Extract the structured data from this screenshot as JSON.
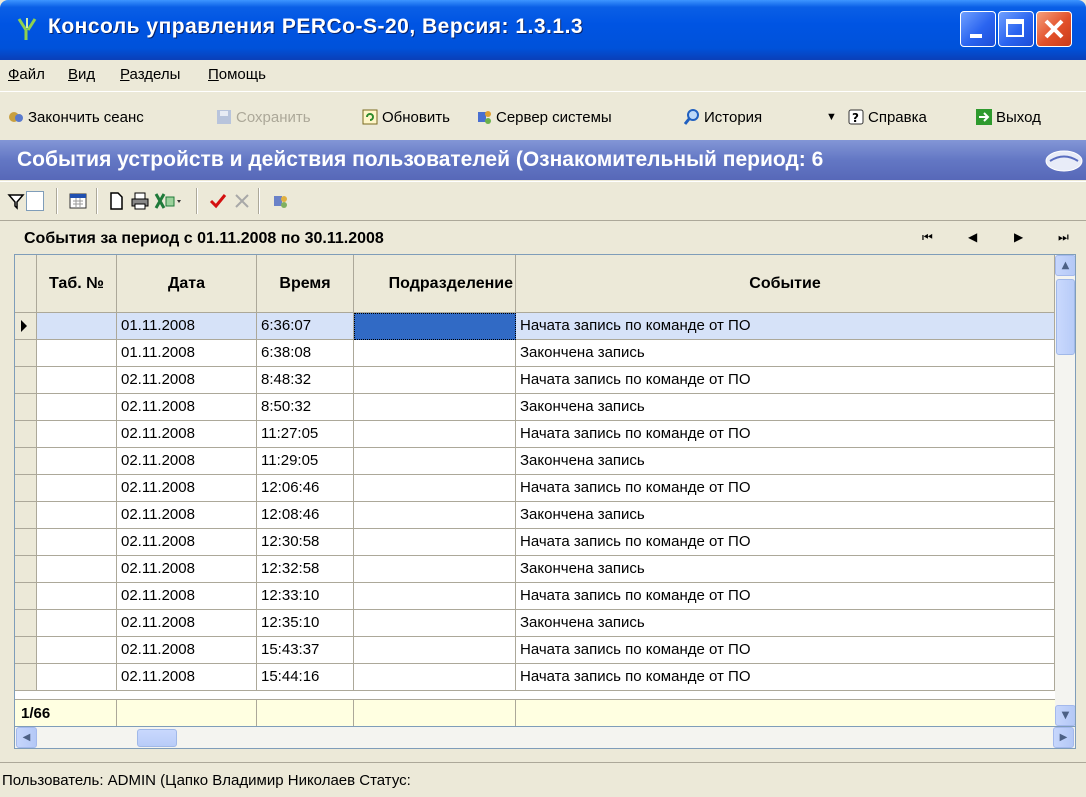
{
  "window": {
    "title": "Консоль управления PERCo-S-20, Версия: 1.3.1.3"
  },
  "menu": [
    "Файл",
    "Вид",
    "Разделы",
    "Помощь"
  ],
  "toolbar": {
    "end_session": "Закончить сеанс",
    "save": "Сохранить",
    "refresh": "Обновить",
    "server": "Сервер системы",
    "history": "История",
    "help": "Справка",
    "exit": "Выход"
  },
  "section": {
    "title": "События устройств и действия пользователей (Ознакомительный период: 6"
  },
  "period": {
    "label": "События за период с 01.11.2008  по 30.11.2008"
  },
  "grid": {
    "columns": [
      "Таб. №",
      "Дата",
      "Время",
      "Подразделение",
      "Событие"
    ],
    "rows": [
      [
        "",
        "01.11.2008",
        "6:36:07",
        "",
        "Начата запись по команде от ПО"
      ],
      [
        "",
        "01.11.2008",
        "6:38:08",
        "",
        "Закончена запись"
      ],
      [
        "",
        "02.11.2008",
        "8:48:32",
        "",
        "Начата запись по команде от ПО"
      ],
      [
        "",
        "02.11.2008",
        "8:50:32",
        "",
        "Закончена запись"
      ],
      [
        "",
        "02.11.2008",
        "11:27:05",
        "",
        "Начата запись по команде от ПО"
      ],
      [
        "",
        "02.11.2008",
        "11:29:05",
        "",
        "Закончена запись"
      ],
      [
        "",
        "02.11.2008",
        "12:06:46",
        "",
        "Начата запись по команде от ПО"
      ],
      [
        "",
        "02.11.2008",
        "12:08:46",
        "",
        "Закончена запись"
      ],
      [
        "",
        "02.11.2008",
        "12:30:58",
        "",
        "Начата запись по команде от ПО"
      ],
      [
        "",
        "02.11.2008",
        "12:32:58",
        "",
        "Закончена запись"
      ],
      [
        "",
        "02.11.2008",
        "12:33:10",
        "",
        "Начата запись по команде от ПО"
      ],
      [
        "",
        "02.11.2008",
        "12:35:10",
        "",
        "Закончена запись"
      ],
      [
        "",
        "02.11.2008",
        "15:43:37",
        "",
        "Начата запись по команде от ПО"
      ],
      [
        "",
        "02.11.2008",
        "15:44:16",
        "",
        "Начата запись по команде от ПО"
      ]
    ],
    "record_counter": "1/66"
  },
  "status": {
    "text": "Пользователь:  ADMIN (Цапко Владимир Николаев Статус:"
  },
  "colors": {
    "title_bar": "#0054E3",
    "section_header": "#6377C4",
    "selection": "#316AC5",
    "footer": "#FFFFE1"
  }
}
